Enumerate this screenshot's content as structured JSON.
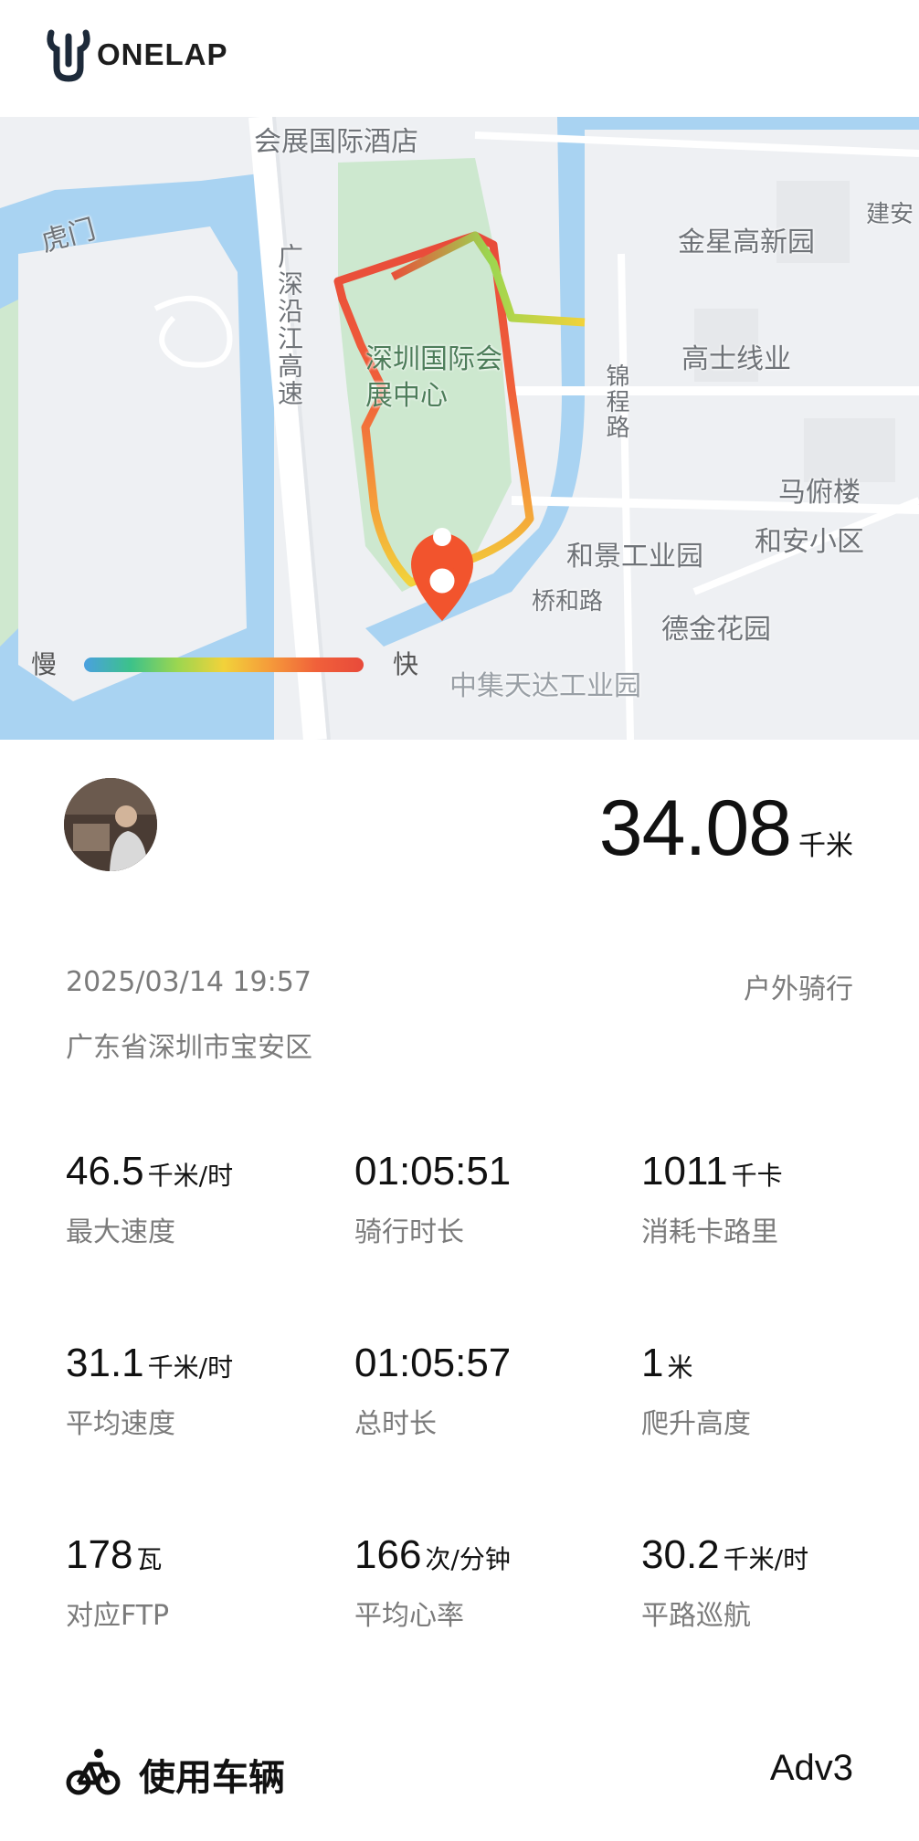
{
  "header": {
    "logo_text": "ONELAP"
  },
  "map": {
    "labels": {
      "hotel": "会展国际酒店",
      "humen": "虎门",
      "expressway": "广深沿江高速",
      "exhibition_center": "深圳国际会展中心",
      "jinxing": "金星高新园",
      "jian_an": "建安",
      "gaoshi": "高士线业",
      "jincheng_road": "锦程路",
      "mafulou": "马俯楼",
      "hean": "和安小区",
      "hejing": "和景工业园",
      "qiaohe_road": "桥和路",
      "dejin": "德金花园",
      "zhongji": "中集天达工业园"
    },
    "legend": {
      "slow": "慢",
      "fast": "快"
    },
    "colors": {
      "route_slow": "#4aa0e0",
      "route_fast": "#e84a3a",
      "pin": "#f2542d",
      "park": "#cde8cf",
      "water": "#a9d3f2"
    }
  },
  "summary": {
    "distance_value": "34.08",
    "distance_unit": "千米"
  },
  "activity": {
    "datetime": "2025/03/14 19:57",
    "type": "户外骑行",
    "location": "广东省深圳市宝安区"
  },
  "stats": [
    {
      "value": "46.5",
      "unit": "千米/时",
      "label": "最大速度"
    },
    {
      "value": "01:05:51",
      "unit": "",
      "label": "骑行时长"
    },
    {
      "value": "1011",
      "unit": "千卡",
      "label": "消耗卡路里"
    },
    {
      "value": "31.1",
      "unit": "千米/时",
      "label": "平均速度"
    },
    {
      "value": "01:05:57",
      "unit": "",
      "label": "总时长"
    },
    {
      "value": "1",
      "unit": "米",
      "label": "爬升高度"
    },
    {
      "value": "178",
      "unit": "瓦",
      "label": "对应FTP"
    },
    {
      "value": "166",
      "unit": "次/分钟",
      "label": "平均心率"
    },
    {
      "value": "30.2",
      "unit": "千米/时",
      "label": "平路巡航"
    }
  ],
  "vehicle": {
    "label": "使用车辆",
    "name": "Adv3",
    "icon": "bicycle-icon"
  }
}
